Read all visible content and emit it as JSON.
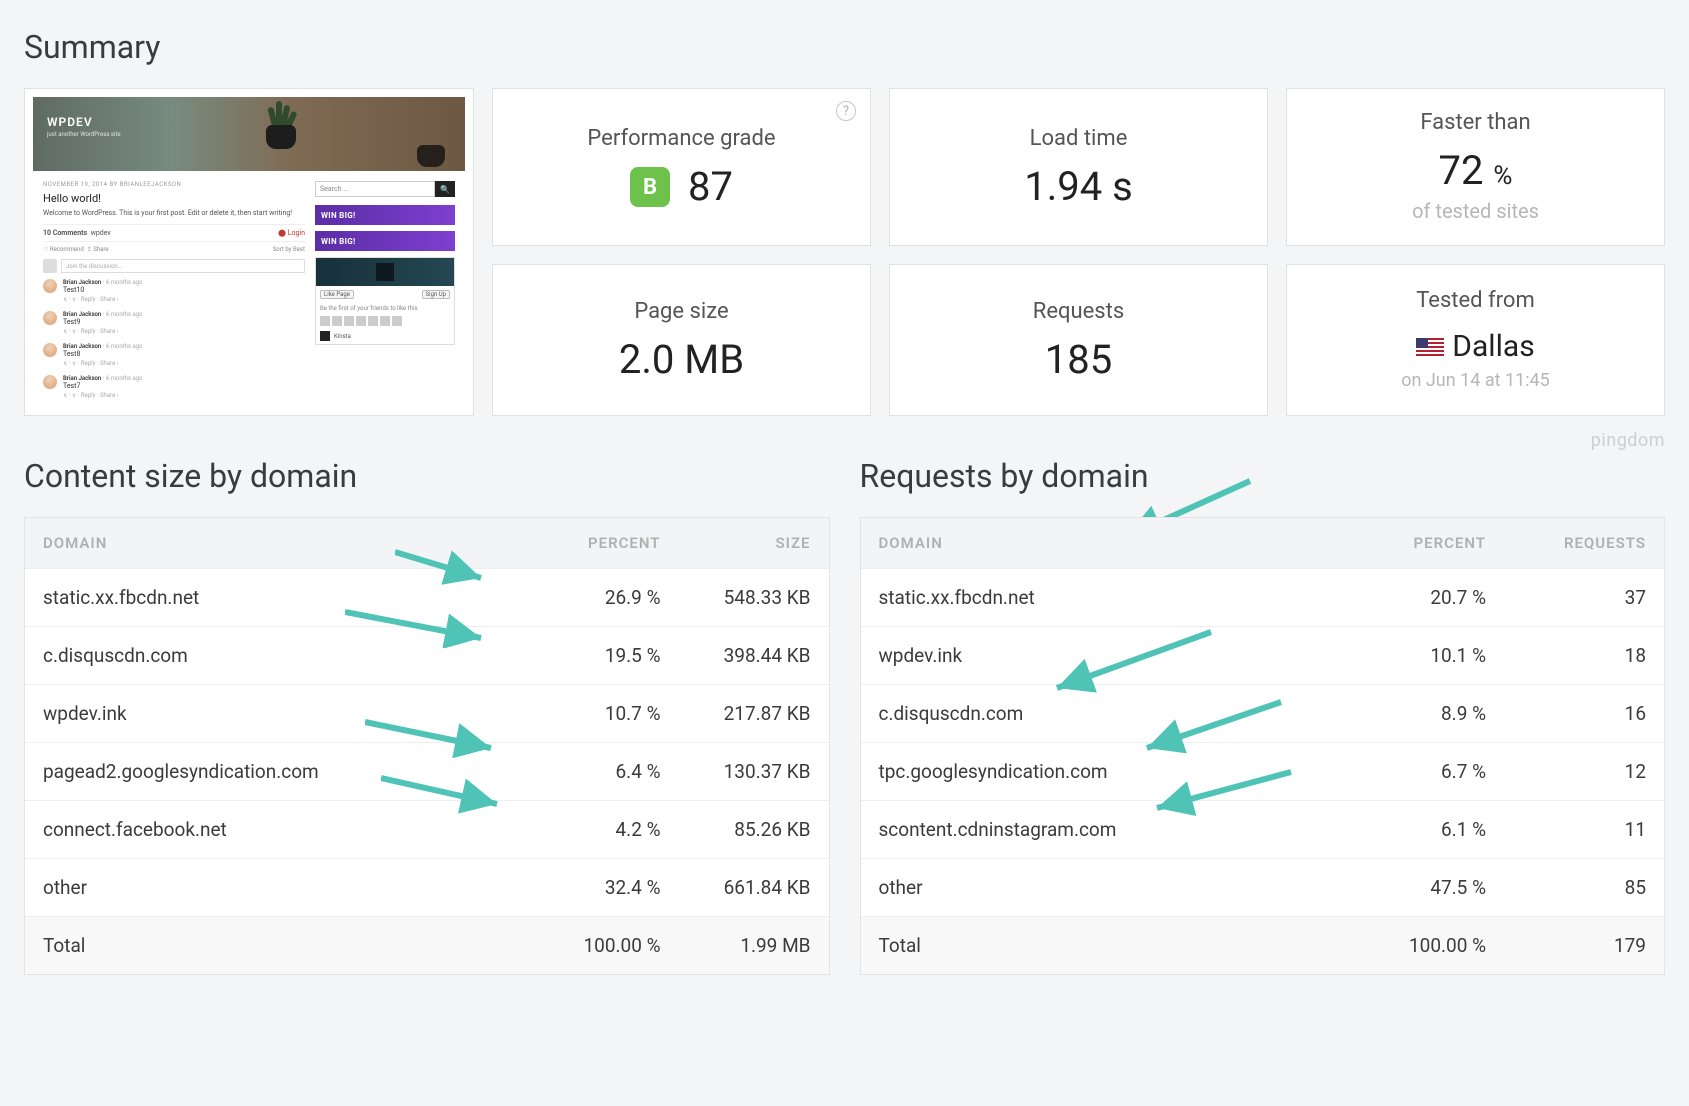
{
  "summary": {
    "heading": "Summary",
    "brand": "pingdom",
    "cards": {
      "grade": {
        "label": "Performance grade",
        "letter": "B",
        "score": "87"
      },
      "load": {
        "label": "Load time",
        "value": "1.94 s"
      },
      "faster": {
        "label": "Faster than",
        "value": "72",
        "unit": "%",
        "sub": "of tested sites"
      },
      "size": {
        "label": "Page size",
        "value": "2.0 MB"
      },
      "req": {
        "label": "Requests",
        "value": "185"
      },
      "from": {
        "label": "Tested from",
        "value": "Dallas",
        "sub": "on Jun 14 at 11:45"
      }
    },
    "thumb": {
      "site_title": "WPDEV",
      "site_tag": "just another WordPress site",
      "post_meta": "NOVEMBER 19, 2014 BY BRIANLEEJACKSON",
      "post_title": "Hello world!",
      "post_body": "Welcome to WordPress. This is your first post. Edit or delete it, then start writing!",
      "comments_count": "10 Comments",
      "comments_site": "wpdev",
      "login": "Login",
      "recommend": "Recommend",
      "share": "Share",
      "sort": "Sort by Best",
      "join": "Join the discussion...",
      "commenter": "Brian Jackson",
      "time": "6 months ago",
      "c_titles": [
        "Test10",
        "Test9",
        "Test8",
        "Test7"
      ],
      "c_actions": "∧ · ∨ · Reply · Share ›",
      "search_ph": "Search ...",
      "banner": "WIN BIG!",
      "fb_card": "Kinsta",
      "fb_like": "Like Page",
      "fb_signup": "Sign Up",
      "fb_friends": "Be the first of your friends to like this"
    }
  },
  "size_table": {
    "heading": "Content size by domain",
    "cols": {
      "domain": "DOMAIN",
      "percent": "PERCENT",
      "size": "SIZE"
    },
    "rows": [
      {
        "domain": "static.xx.fbcdn.net",
        "percent": "26.9 %",
        "size": "548.33 KB"
      },
      {
        "domain": "c.disquscdn.com",
        "percent": "19.5 %",
        "size": "398.44 KB"
      },
      {
        "domain": "wpdev.ink",
        "percent": "10.7 %",
        "size": "217.87 KB"
      },
      {
        "domain": "pagead2.googlesyndication.com",
        "percent": "6.4 %",
        "size": "130.37 KB"
      },
      {
        "domain": "connect.facebook.net",
        "percent": "4.2 %",
        "size": "85.26 KB"
      },
      {
        "domain": "other",
        "percent": "32.4 %",
        "size": "661.84 KB"
      }
    ],
    "total": {
      "domain": "Total",
      "percent": "100.00 %",
      "size": "1.99 MB"
    }
  },
  "req_table": {
    "heading": "Requests by domain",
    "cols": {
      "domain": "DOMAIN",
      "percent": "PERCENT",
      "req": "REQUESTS"
    },
    "rows": [
      {
        "domain": "static.xx.fbcdn.net",
        "percent": "20.7 %",
        "req": "37"
      },
      {
        "domain": "wpdev.ink",
        "percent": "10.1 %",
        "req": "18"
      },
      {
        "domain": "c.disquscdn.com",
        "percent": "8.9 %",
        "req": "16"
      },
      {
        "domain": "tpc.googlesyndication.com",
        "percent": "6.7 %",
        "req": "12"
      },
      {
        "domain": "scontent.cdninstagram.com",
        "percent": "6.1 %",
        "req": "11"
      },
      {
        "domain": "other",
        "percent": "47.5 %",
        "req": "85"
      }
    ],
    "total": {
      "domain": "Total",
      "percent": "100.00 %",
      "req": "179"
    }
  },
  "colors": {
    "arrow": "#4ec3b6"
  }
}
